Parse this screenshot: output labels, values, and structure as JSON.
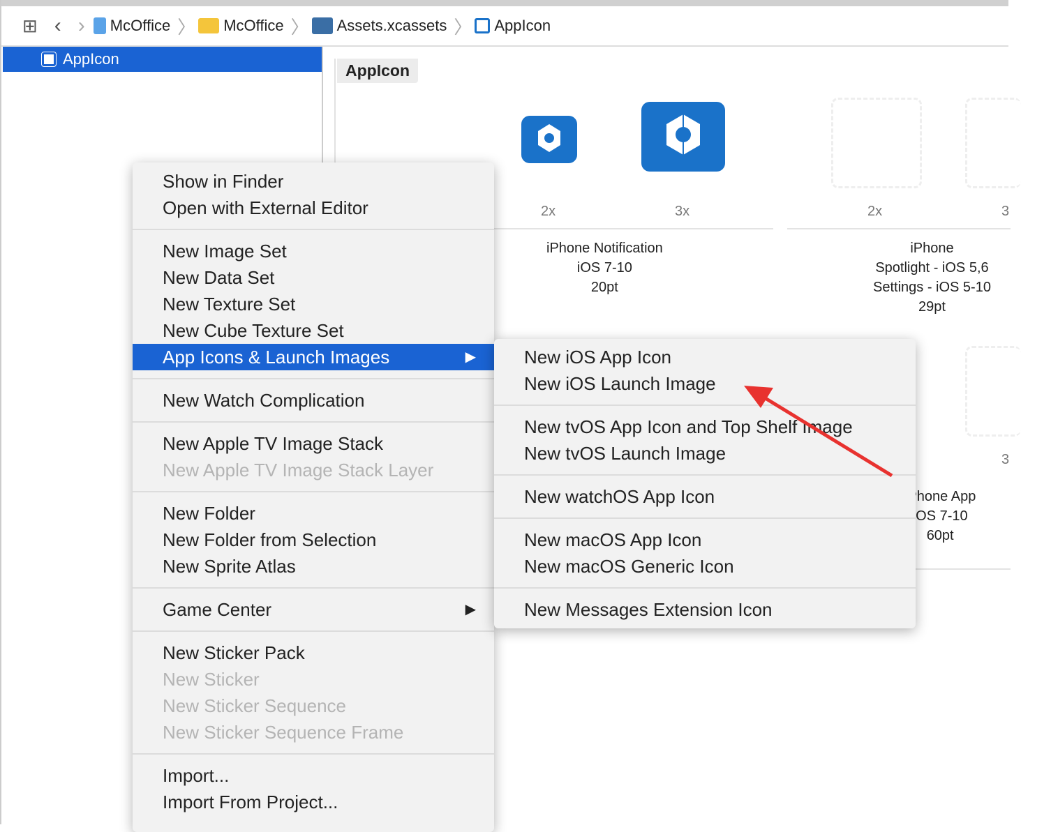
{
  "breadcrumb": {
    "items": [
      {
        "label": "McOffice",
        "icon": "xcode-project-icon"
      },
      {
        "label": "McOffice",
        "icon": "folder-icon"
      },
      {
        "label": "Assets.xcassets",
        "icon": "asset-catalog-icon"
      },
      {
        "label": "AppIcon",
        "icon": "app-icon-set-icon"
      }
    ]
  },
  "sidebar": {
    "selected": "AppIcon"
  },
  "content": {
    "title": "AppIcon",
    "groups": [
      {
        "scales": [
          "2x",
          "3x"
        ],
        "caption": [
          "iPhone Notification",
          "iOS 7-10",
          "20pt"
        ]
      },
      {
        "scales": [
          "2x",
          "3"
        ],
        "caption": [
          "iPhone",
          "Spotlight - iOS 5,6",
          "Settings - iOS 5-10",
          "29pt"
        ]
      },
      {
        "scales": [
          "3"
        ],
        "caption": [
          "iPhone App",
          "iOS 7-10",
          "60pt"
        ]
      }
    ]
  },
  "context_menu": {
    "groups": [
      [
        {
          "label": "Show in Finder"
        },
        {
          "label": "Open with External Editor"
        }
      ],
      [
        {
          "label": "New Image Set"
        },
        {
          "label": "New Data Set"
        },
        {
          "label": "New Texture Set"
        },
        {
          "label": "New Cube Texture Set"
        },
        {
          "label": "App Icons & Launch Images",
          "submenu": true,
          "highlighted": true
        }
      ],
      [
        {
          "label": "New Watch Complication"
        }
      ],
      [
        {
          "label": "New Apple TV Image Stack"
        },
        {
          "label": "New Apple TV Image Stack Layer",
          "disabled": true
        }
      ],
      [
        {
          "label": "New Folder"
        },
        {
          "label": "New Folder from Selection"
        },
        {
          "label": "New Sprite Atlas"
        }
      ],
      [
        {
          "label": "Game Center",
          "submenu": true
        }
      ],
      [
        {
          "label": "New Sticker Pack"
        },
        {
          "label": "New Sticker",
          "disabled": true
        },
        {
          "label": "New Sticker Sequence",
          "disabled": true
        },
        {
          "label": "New Sticker Sequence Frame",
          "disabled": true
        }
      ],
      [
        {
          "label": "Import..."
        },
        {
          "label": "Import From Project..."
        }
      ]
    ]
  },
  "submenu": {
    "groups": [
      [
        {
          "label": "New iOS App Icon"
        },
        {
          "label": "New iOS Launch Image"
        }
      ],
      [
        {
          "label": "New tvOS App Icon and Top Shelf Image"
        },
        {
          "label": "New tvOS Launch Image"
        }
      ],
      [
        {
          "label": "New watchOS App Icon"
        }
      ],
      [
        {
          "label": "New macOS App Icon"
        },
        {
          "label": "New macOS Generic Icon"
        }
      ],
      [
        {
          "label": "New Messages Extension Icon"
        }
      ]
    ]
  },
  "colors": {
    "accent": "#1a63d3",
    "icon_blue": "#1a72c9",
    "annotation_arrow": "#e8322f"
  }
}
